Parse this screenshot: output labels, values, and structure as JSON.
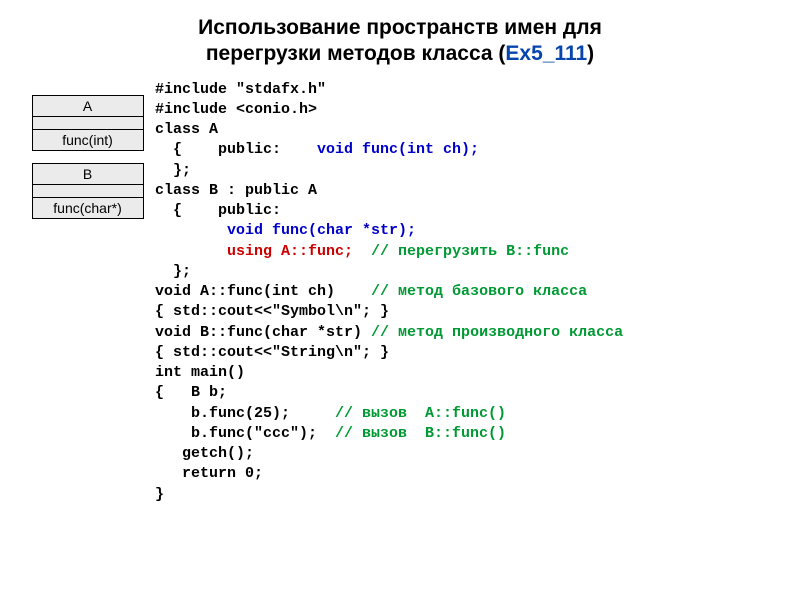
{
  "title": {
    "line1": "Использование пространств имен для",
    "line2_prefix": "перегрузки методов класса (",
    "link": "Ex5_111",
    "line2_suffix": ")"
  },
  "uml": {
    "classA": {
      "name": "A",
      "method": "func(int)"
    },
    "classB": {
      "name": "B",
      "method": "func(char*)"
    }
  },
  "code": {
    "l1": "#include \"stdafx.h\"",
    "l2": "#include <conio.h>",
    "l3": "class A",
    "l4a": "  {    public:    ",
    "l4b": "void func(int ch);",
    "l5": "  };",
    "l6": "class B : public A",
    "l7": "  {    public:",
    "l8": "        void func(char *str);",
    "l9a": "        ",
    "l9b": "using A::func;",
    "l9c": "  // перегрузить B::func",
    "l10": "  };",
    "l11a": "void A::func(int ch)    ",
    "l11b": "// метод базового класса",
    "l12": "{ std::cout<<\"Symbol\\n\"; }",
    "l13a": "void B::func(char *str) ",
    "l13b": "// метод производного класса",
    "l14": "{ std::cout<<\"String\\n\"; }",
    "l15": "int main()",
    "l16": "{   B b;",
    "l17a": "    b.func(25);     ",
    "l17b": "// вызов  A::func()",
    "l18a": "    b.func(\"ccc\");  ",
    "l18b": "// вызов  B::func()",
    "l19": "   getch();",
    "l20": "   return 0;",
    "l21": "}"
  }
}
